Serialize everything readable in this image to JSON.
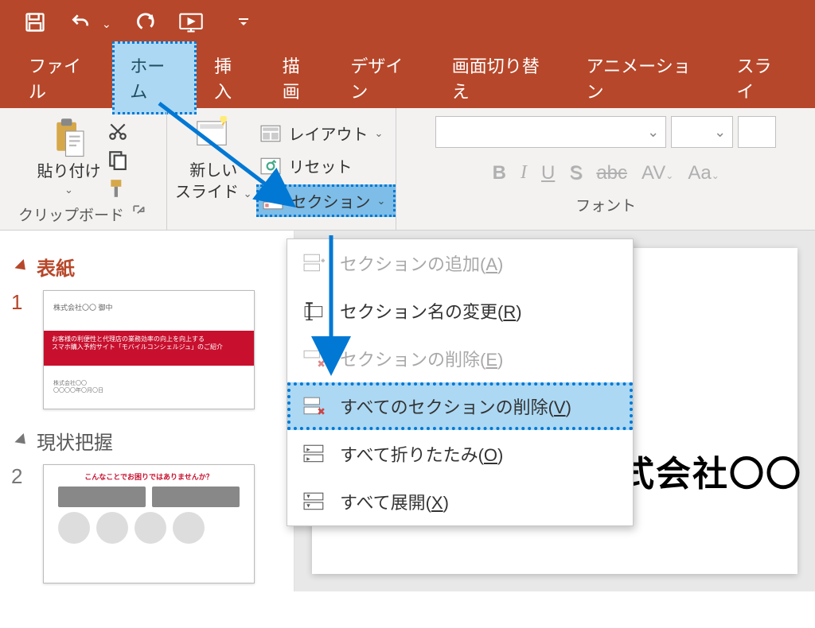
{
  "tabs": {
    "file": "ファイル",
    "home": "ホーム",
    "insert": "挿入",
    "draw": "描画",
    "design": "デザイン",
    "transition": "画面切り替え",
    "animation": "アニメーション",
    "slideshow": "スライ"
  },
  "ribbon": {
    "paste": "貼り付け",
    "clipboard": "クリップボード",
    "newslide_l1": "新しい",
    "newslide_l2": "スライド",
    "layout": "レイアウト",
    "reset": "リセット",
    "section": "セクション",
    "font_group": "フォント",
    "bold": "B",
    "italic": "I",
    "underline": "U",
    "shadow": "S",
    "strike": "abc",
    "spacing": "AV",
    "fontsize": "Aa"
  },
  "menu": {
    "add": "セクションの追加",
    "add_u": "A",
    "rename": "セクション名の変更",
    "rename_u": "R",
    "delete": "セクションの削除",
    "delete_u": "E",
    "delete_all": "すべてのセクションの削除",
    "delete_all_u": "V",
    "collapse": "すべて折りたたみ",
    "collapse_u": "O",
    "expand": "すべて展開",
    "expand_u": "X"
  },
  "outline": {
    "sec1": "表紙",
    "sec2": "現状把握",
    "n1": "1",
    "n2": "2"
  },
  "slide": {
    "title": "株式会社〇〇",
    "t1_hdr": "株式会社〇〇 御中",
    "t1_band1": "お客様の利便性と代理店の業務効率の向上を向上する",
    "t1_band2": "スマホ購入予約サイト「モバイルコンシェルジュ」のご紹介",
    "t2_hdr": "こんなことでお困りではありませんか？"
  }
}
